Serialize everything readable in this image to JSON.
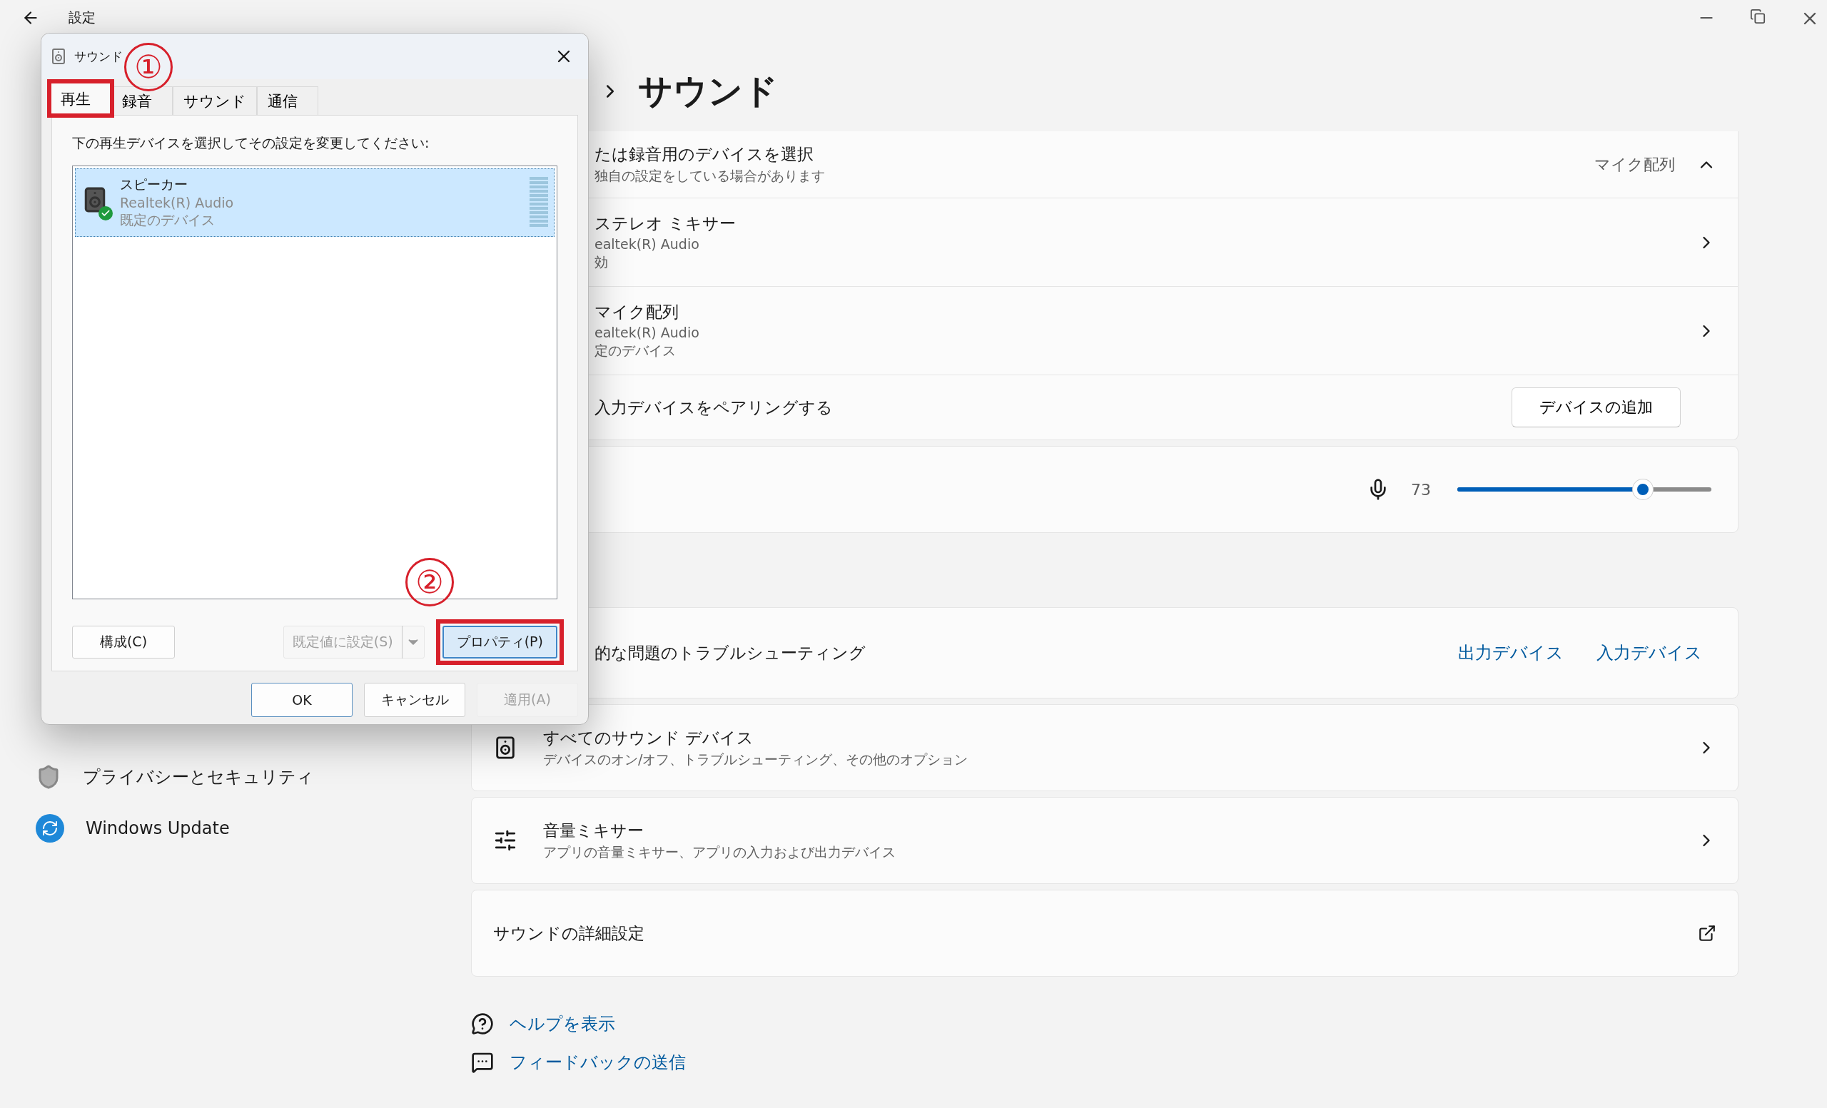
{
  "window": {
    "title": "設定"
  },
  "sidebar": {
    "items": [
      {
        "label": "プライバシーとセキュリティ",
        "kind": "privacy"
      },
      {
        "label": "Windows Update",
        "kind": "update"
      }
    ]
  },
  "page_title": "サウンド",
  "input_section": {
    "title": "たは録音用のデバイスを選択",
    "subtitle": "独自の設定をしている場合があります",
    "value": "マイク配列",
    "expanded": true,
    "devices": [
      {
        "name": "ステレオ ミキサー",
        "driver": "ealtek(R) Audio",
        "status": "効"
      },
      {
        "name": "マイク配列",
        "driver": "ealtek(R) Audio",
        "status": "定のデバイス"
      }
    ],
    "pair": {
      "label": "入力デバイスをペアリングする",
      "button": "デバイスの追加"
    },
    "volume": {
      "reading": "73",
      "level": 0.73
    }
  },
  "troubleshoot": {
    "label": "的な問題のトラブルシューティング",
    "links": [
      "出力デバイス",
      "入力デバイス"
    ]
  },
  "nav_cards": [
    {
      "title": "すべてのサウンド デバイス",
      "subtitle": "デバイスのオン/オフ、トラブルシューティング、その他のオプション",
      "kind": "speaker"
    },
    {
      "title": "音量ミキサー",
      "subtitle": "アプリの音量ミキサー、アプリの入力および出力デバイス",
      "kind": "mixer"
    },
    {
      "title": "サウンドの詳細設定",
      "kind": "external"
    }
  ],
  "help_links": [
    {
      "label": "ヘルプを表示",
      "kind": "help"
    },
    {
      "label": "フィードバックの送信",
      "kind": "feedback"
    }
  ],
  "dialog": {
    "title": "サウンド",
    "tabs": [
      {
        "label": "再生",
        "selected": true,
        "highlighted": true
      },
      {
        "label": "録音",
        "selected": false,
        "highlighted": false
      },
      {
        "label": "サウンド",
        "selected": false,
        "highlighted": false
      },
      {
        "label": "通信",
        "selected": false,
        "highlighted": false
      }
    ],
    "instruction": "下の再生デバイスを選択してその設定を変更してください:",
    "devices": [
      {
        "name": "スピーカー",
        "driver": "Realtek(R) Audio",
        "status": "既定のデバイス",
        "selected": true,
        "default": true
      }
    ],
    "buttons": [
      {
        "label": "構成(C)",
        "kind": "plain",
        "disabled": false,
        "focused": false,
        "highlighted": false
      },
      {
        "label": "既定値に設定(S)",
        "kind": "split",
        "disabled": true
      },
      {
        "label": "プロパティ(P)",
        "kind": "plain",
        "disabled": false,
        "focused": true,
        "highlighted": true
      }
    ],
    "footer_buttons": [
      {
        "label": "OK",
        "disabled": false,
        "default": true
      },
      {
        "label": "キャンセル",
        "disabled": false,
        "default": false
      },
      {
        "label": "適用(A)",
        "disabled": true,
        "default": false
      }
    ]
  },
  "annotations": [
    {
      "label": "①"
    },
    {
      "label": "②"
    }
  ]
}
